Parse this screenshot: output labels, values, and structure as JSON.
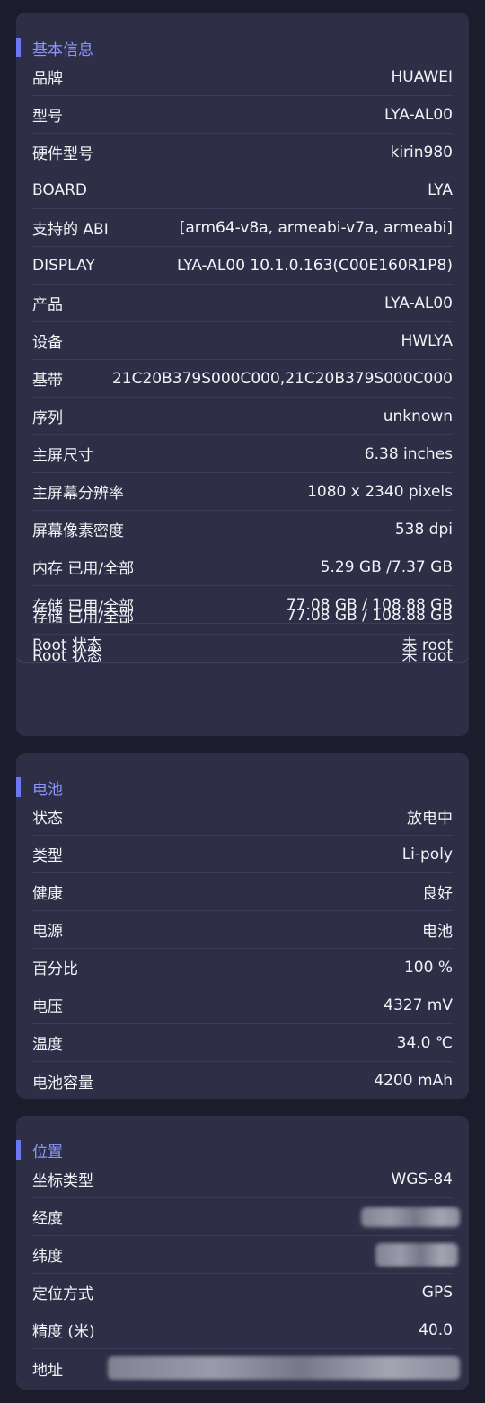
{
  "basic": {
    "title": "基本信息",
    "rows": [
      {
        "label": "品牌",
        "value": "HUAWEI"
      },
      {
        "label": "型号",
        "value": "LYA-AL00"
      },
      {
        "label": "硬件型号",
        "value": "kirin980"
      },
      {
        "label": "BOARD",
        "value": "LYA"
      },
      {
        "label": "支持的 ABI",
        "value": "[arm64-v8a, armeabi-v7a, armeabi]"
      },
      {
        "label": "DISPLAY",
        "value": "LYA-AL00 10.1.0.163(C00E160R1P8)"
      },
      {
        "label": "产品",
        "value": "LYA-AL00"
      },
      {
        "label": "设备",
        "value": "HWLYA"
      },
      {
        "label": "基带",
        "value": "21C20B379S000C000,21C20B379S000C000"
      },
      {
        "label": "序列",
        "value": "unknown"
      },
      {
        "label": "主屏尺寸",
        "value": "6.38 inches"
      },
      {
        "label": "主屏幕分辨率",
        "value": "1080 x 2340 pixels"
      },
      {
        "label": "屏幕像素密度",
        "value": "538 dpi"
      },
      {
        "label": "内存 已用/全部",
        "value": "5.29 GB /7.37 GB"
      },
      {
        "label": "存储 已用/全部",
        "value": "77.08 GB / 108.88 GB"
      },
      {
        "label": "Root 状态",
        "value": "未 root"
      }
    ],
    "overlap_rows": [
      {
        "label": "存储 已用/全部",
        "value": "77.08 GB / 108.88 GB"
      },
      {
        "label": "Root 状态",
        "value": "未 root"
      }
    ]
  },
  "battery": {
    "title": "电池",
    "rows": [
      {
        "label": "状态",
        "value": "放电中"
      },
      {
        "label": "类型",
        "value": "Li-poly"
      },
      {
        "label": "健康",
        "value": "良好"
      },
      {
        "label": "电源",
        "value": "电池"
      },
      {
        "label": "百分比",
        "value": "100 %"
      },
      {
        "label": "电压",
        "value": "4327 mV"
      },
      {
        "label": "温度",
        "value": "34.0 ℃"
      },
      {
        "label": "电池容量",
        "value": "4200 mAh"
      }
    ]
  },
  "location": {
    "title": "位置",
    "rows": [
      {
        "label": "坐标类型",
        "value": "WGS-84"
      },
      {
        "label": "经度",
        "value": ""
      },
      {
        "label": "纬度",
        "value": ""
      },
      {
        "label": "定位方式",
        "value": "GPS"
      },
      {
        "label": "精度 (米)",
        "value": "40.0"
      },
      {
        "label": "地址",
        "value": ""
      }
    ]
  }
}
